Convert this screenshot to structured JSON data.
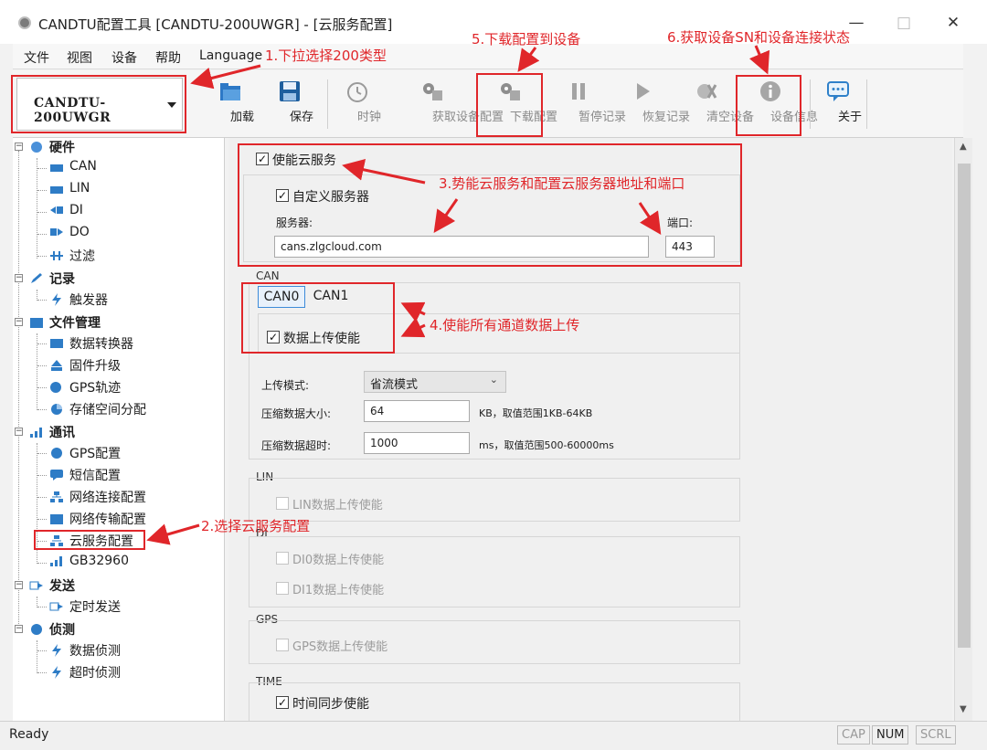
{
  "window": {
    "title": "CANDTU配置工具 [CANDTU-200UWGR] - [云服务配置]",
    "minimize": "—",
    "maximize": "□",
    "close": "✕"
  },
  "menu": [
    "文件",
    "视图",
    "设备",
    "帮助",
    "Language"
  ],
  "device_select": {
    "value": "CANDTU-200UWGR"
  },
  "toolbar": [
    {
      "label": "加载",
      "icon": "folder-open-icon",
      "enabled": true
    },
    {
      "label": "保存",
      "icon": "floppy-disk-icon",
      "enabled": true
    },
    {
      "label": "时钟",
      "icon": "clock-icon",
      "enabled": false
    },
    {
      "label": "获取设备配置",
      "icon": "device-upload-icon",
      "enabled": false
    },
    {
      "label": "下载配置",
      "icon": "device-download-icon",
      "enabled": false
    },
    {
      "label": "暂停记录",
      "icon": "pause-icon",
      "enabled": false
    },
    {
      "label": "恢复记录",
      "icon": "play-icon",
      "enabled": false
    },
    {
      "label": "清空设备",
      "icon": "clear-device-icon",
      "enabled": false
    },
    {
      "label": "设备信息",
      "icon": "info-icon",
      "enabled": false
    },
    {
      "label": "关于",
      "icon": "chat-bubble-icon",
      "enabled": true
    }
  ],
  "tree": {
    "hardware": {
      "label": "硬件",
      "children": [
        "CAN",
        "LIN",
        "DI",
        "DO",
        "过滤"
      ]
    },
    "record": {
      "label": "记录",
      "children": [
        "触发器"
      ]
    },
    "file_mgmt": {
      "label": "文件管理",
      "children": [
        "数据转换器",
        "固件升级",
        "GPS轨迹",
        "存储空间分配"
      ]
    },
    "comm": {
      "label": "通讯",
      "children": [
        "GPS配置",
        "短信配置",
        "网络连接配置",
        "网络传输配置",
        "云服务配置",
        "GB32960"
      ]
    },
    "send": {
      "label": "发送",
      "children": [
        "定时发送"
      ]
    },
    "detect": {
      "label": "侦测",
      "children": [
        "数据侦测",
        "超时侦测"
      ]
    }
  },
  "cloud": {
    "enable_label": "使能云服务",
    "custom_server_label": "自定义服务器",
    "server_label": "服务器:",
    "server_value": "cans.zlgcloud.com",
    "port_label": "端口:",
    "port_value": "443"
  },
  "can": {
    "group_title": "CAN",
    "tabs": [
      "CAN0",
      "CAN1"
    ],
    "upload_label": "数据上传使能",
    "mode_label": "上传模式:",
    "mode_value": "省流模式",
    "size_label": "压缩数据大小:",
    "size_value": "64",
    "size_hint": "KB，取值范围1KB-64KB",
    "timeout_label": "压缩数据超时:",
    "timeout_value": "1000",
    "timeout_hint": "ms，取值范围500-60000ms"
  },
  "lin": {
    "group_title": "LIN",
    "upload_label": "LIN数据上传使能"
  },
  "di": {
    "group_title": "DI",
    "di0_label": "DI0数据上传使能",
    "di1_label": "DI1数据上传使能"
  },
  "gps": {
    "group_title": "GPS",
    "upload_label": "GPS数据上传使能"
  },
  "time": {
    "group_title": "TIME",
    "sync_label": "时间同步使能"
  },
  "annotations": {
    "a1": "1.下拉选择200类型",
    "a2": "2.选择云服务配置",
    "a3": "3.势能云服务和配置云服务器地址和端口",
    "a4": "4.使能所有通道数据上传",
    "a5": "5.下载配置到设备",
    "a6": "6.获取设备SN和设备连接状态"
  },
  "colors": {
    "annotation": "#e0262a",
    "accent": "#2e6fb7"
  },
  "status": {
    "text": "Ready",
    "indicators": [
      "CAP",
      "NUM",
      "SCRL"
    ]
  }
}
